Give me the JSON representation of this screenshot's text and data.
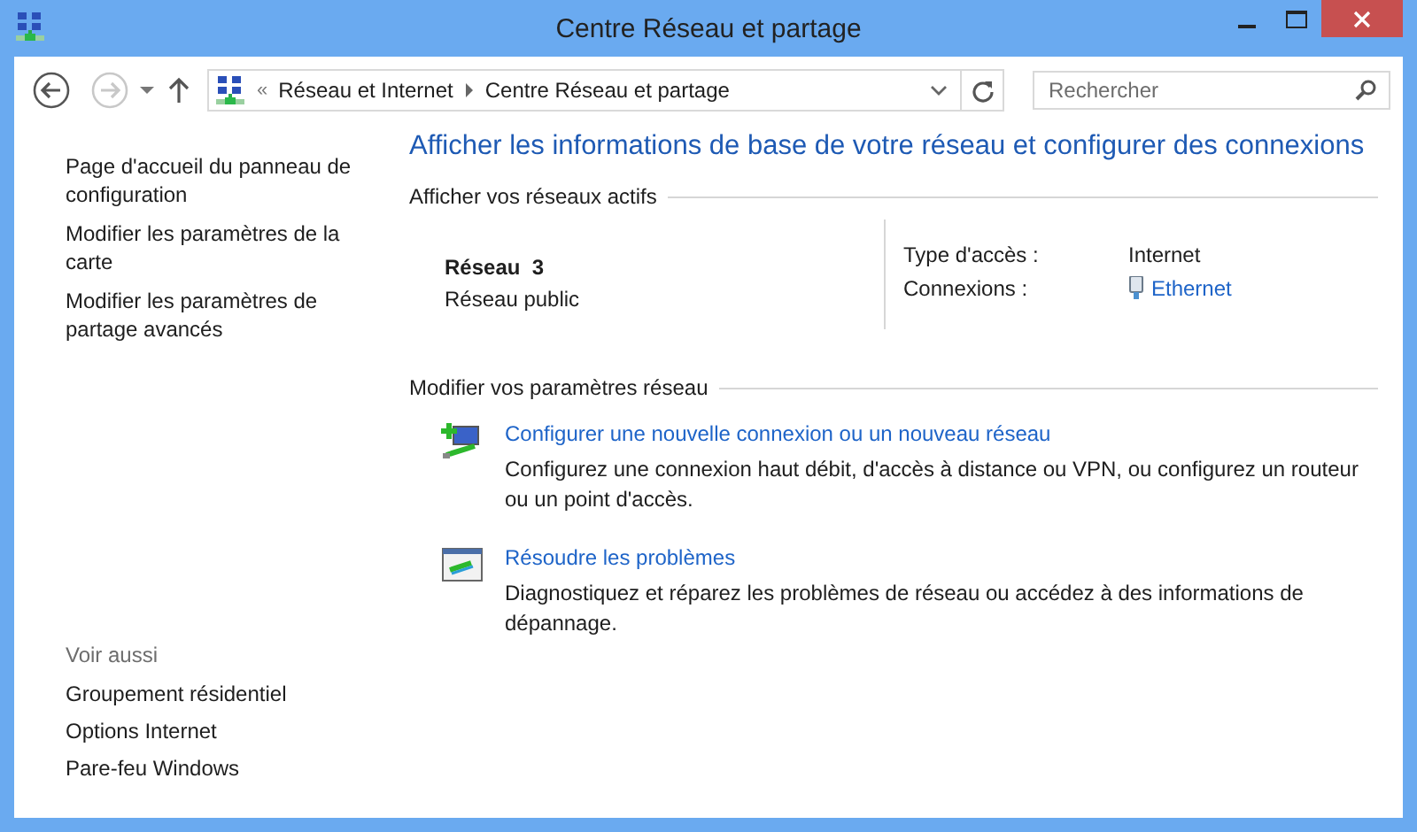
{
  "window": {
    "title": "Centre Réseau et partage"
  },
  "navigation": {
    "back": {
      "disabled": false
    },
    "forward": {
      "disabled": true
    }
  },
  "address_bar": {
    "separator": "«",
    "path": [
      "Réseau et Internet",
      "Centre Réseau et partage"
    ]
  },
  "search": {
    "placeholder": "Rechercher"
  },
  "sidebar": {
    "links": [
      "Page d'accueil du panneau de configuration",
      "Modifier les paramètres de la carte",
      "Modifier les paramètres de partage avancés"
    ],
    "see_also": {
      "heading": "Voir aussi",
      "links": [
        "Groupement résidentiel",
        "Options Internet",
        "Pare-feu Windows"
      ]
    }
  },
  "main": {
    "title": "Afficher les informations de base de votre réseau et configurer des connexions",
    "active_networks": {
      "heading": "Afficher vos réseaux actifs",
      "network": {
        "name": "Réseau  3",
        "category": "Réseau public"
      },
      "details": [
        {
          "label": "Type d'accès :",
          "value": "Internet",
          "kind": "text"
        },
        {
          "label": "Connexions :",
          "value": "Ethernet",
          "kind": "link"
        }
      ]
    },
    "change_settings": {
      "heading": "Modifier vos paramètres réseau",
      "tasks": [
        {
          "kind": "new-connection",
          "title": "Configurer une nouvelle connexion ou un nouveau réseau",
          "description": "Configurez une connexion haut débit, d'accès à distance ou VPN, ou configurez un routeur ou un point d'accès."
        },
        {
          "kind": "troubleshoot",
          "title": "Résoudre les problèmes",
          "description": "Diagnostiquez et réparez les problèmes de réseau ou accédez à des informations de dépannage."
        }
      ]
    }
  }
}
